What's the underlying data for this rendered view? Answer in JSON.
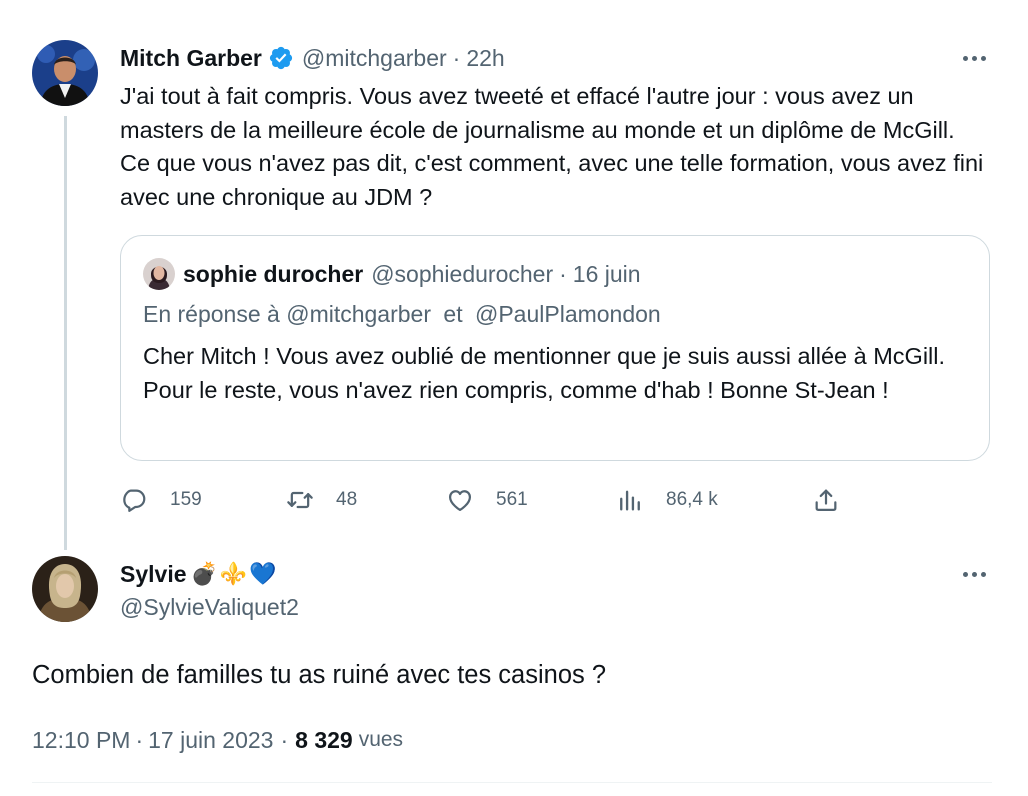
{
  "main_tweet": {
    "author_name": "Mitch Garber",
    "handle": "@mitchgarber",
    "separator": "·",
    "time": "22h",
    "text": "J'ai tout à fait compris. Vous avez tweeté et effacé l'autre jour : vous avez un masters de la meilleure école de journalisme au monde et un diplôme de McGill. Ce que vous n'avez pas dit, c'est comment, avec une telle formation, vous avez fini avec une chronique au JDM ?",
    "verified_color": "#1d9bf0",
    "quote": {
      "author_name": "sophie durocher",
      "handle": "@sophiedurocher",
      "separator": "·",
      "date": "16 juin",
      "reply_prefix": "En réponse à",
      "reply_to_1": "@mitchgarber",
      "reply_and": "et",
      "reply_to_2": "@PaulPlamondon",
      "text": "Cher Mitch ! Vous avez oublié de mentionner que je suis aussi allée à McGill. Pour le reste, vous n'avez rien compris, comme d'hab ! Bonne St-Jean !"
    },
    "actions": {
      "replies": "159",
      "retweets": "48",
      "likes": "561",
      "views": "86,4 k"
    }
  },
  "reply_tweet": {
    "author_name": "Sylvie",
    "emoji": "💣⚜️💙",
    "handle": "@SylvieValiquet2",
    "text": "Combien de familles tu as ruiné avec tes casinos ?",
    "time": "12:10 PM",
    "separator": "·",
    "date": "17 juin 2023",
    "separator2": "·",
    "views_count": "8 329",
    "views_label": "vues"
  },
  "colors": {
    "text": "#0f1419",
    "muted": "#536471",
    "border": "#cfd9de",
    "accent": "#1d9bf0"
  }
}
